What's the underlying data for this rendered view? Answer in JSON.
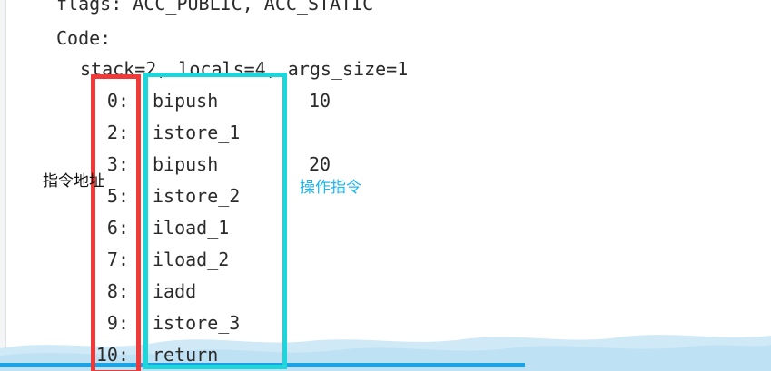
{
  "header": {
    "flags_line": "flags: ACC_PUBLIC, ACC_STATIC",
    "code_label": "Code:",
    "stack_line": "stack=2, locals=4, args_size=1"
  },
  "instructions": [
    {
      "offset": "0:",
      "opcode": "bipush",
      "operand": "10"
    },
    {
      "offset": "2:",
      "opcode": "istore_1",
      "operand": ""
    },
    {
      "offset": "3:",
      "opcode": "bipush",
      "operand": "20"
    },
    {
      "offset": "5:",
      "opcode": "istore_2",
      "operand": ""
    },
    {
      "offset": "6:",
      "opcode": "iload_1",
      "operand": ""
    },
    {
      "offset": "7:",
      "opcode": "iload_2",
      "operand": ""
    },
    {
      "offset": "8:",
      "opcode": "iadd",
      "operand": ""
    },
    {
      "offset": "9:",
      "opcode": "istore_3",
      "operand": ""
    },
    {
      "offset": "10:",
      "opcode": "return",
      "operand": ""
    }
  ],
  "annotations": {
    "address_label": "指令地址",
    "operation_label": "操作指令",
    "address_box_color": "#f03a3a",
    "operation_box_color": "#1dd6dc",
    "operation_label_color": "#1fb6ee"
  }
}
